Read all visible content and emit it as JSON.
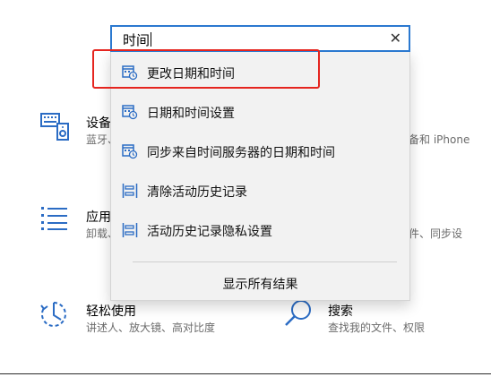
{
  "search": {
    "value": "时间"
  },
  "results": [
    {
      "label": "更改日期和时间",
      "icon": "calendar-clock-icon"
    },
    {
      "label": "日期和时间设置",
      "icon": "calendar-clock-icon"
    },
    {
      "label": "同步来自时间服务器的日期和时间",
      "icon": "calendar-clock-icon"
    },
    {
      "label": "清除活动历史记录",
      "icon": "timeline-icon"
    },
    {
      "label": "活动历史记录隐私设置",
      "icon": "timeline-icon"
    }
  ],
  "show_all_label": "显示所有结果",
  "background": {
    "devices": {
      "title": "设备",
      "sub": "蓝牙、",
      "sub_right": "备和 iPhone"
    },
    "apps": {
      "title": "应用",
      "sub": "卸载、",
      "sub_right": "件、同步设"
    },
    "ease": {
      "title": "轻松使用",
      "sub": "讲述人、放大镜、高对比度"
    },
    "search": {
      "title": "搜索",
      "sub": "查找我的文件、权限"
    }
  },
  "colors": {
    "accent": "#2b79d0",
    "highlight": "#e5251f",
    "icon_blue": "#2b6cc4"
  }
}
